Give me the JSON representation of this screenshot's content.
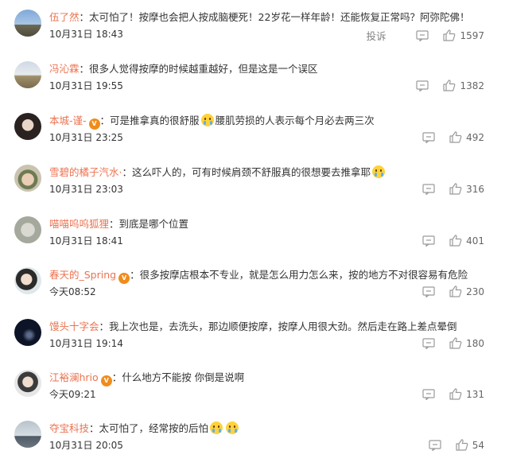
{
  "labels": {
    "report": "投诉"
  },
  "colors": {
    "username": "#eb7350",
    "text": "#333333",
    "icon": "#9a9a9a"
  },
  "comments": [
    {
      "user": "伍了然",
      "vip": false,
      "sep": "：",
      "text": "太可怕了！按摩也会把人按成脑梗死！22岁花一样年龄！还能恢复正常吗？阿弥陀佛！",
      "emojis": [],
      "time": "10月31日 18:43",
      "likes": "1597",
      "report": true
    },
    {
      "user": "冯沁霖",
      "vip": false,
      "sep": "：",
      "text": "很多人觉得按摩的时候越重越好，但是这是一个误区",
      "emojis": [],
      "time": "10月31日 19:55",
      "likes": "1382",
      "report": false
    },
    {
      "user": "本城-谨-",
      "vip": true,
      "sep": "：",
      "text": "可是推拿真的很舒服",
      "text2": "腰肌劳损的人表示每个月必去两三次",
      "emojis": [
        "crying-face"
      ],
      "time": "10月31日 23:25",
      "likes": "492",
      "report": false
    },
    {
      "user": "雪碧的橘子汽水·",
      "vip": false,
      "sep": "：",
      "text": "这么吓人的，可有时候肩颈不舒服真的很想要去推拿耶",
      "emojis": [
        "crying-face"
      ],
      "time": "10月31日 23:03",
      "likes": "316",
      "report": false
    },
    {
      "user": "喵喵呜呜狐狸",
      "vip": false,
      "sep": "：",
      "text": "到底是哪个位置",
      "emojis": [],
      "time": "10月31日 18:41",
      "likes": "401",
      "report": false
    },
    {
      "user": "春天的_Spring",
      "vip": true,
      "sep": "：",
      "text": "很多按摩店根本不专业，就是怎么用力怎么来，按的地方不对很容易有危险",
      "emojis": [],
      "time": "今天08:52",
      "likes": "230",
      "report": false
    },
    {
      "user": "馒头十字会",
      "vip": false,
      "sep": "：",
      "text": "我上次也是，去洗头，那边顺便按摩，按摩人用很大劲。然后走在路上差点晕倒",
      "emojis": [],
      "time": "10月31日 19:14",
      "likes": "180",
      "report": false
    },
    {
      "user": "江裕澜hrio",
      "vip": true,
      "sep": "：",
      "text": "什么地方不能按 你倒是说啊",
      "emojis": [],
      "time": "今天09:21",
      "likes": "131",
      "report": false
    },
    {
      "user": "夺宝科技",
      "vip": false,
      "sep": "：",
      "text": "太可怕了，经常按的后怕",
      "emojis": [
        "crying-face",
        "crying-face"
      ],
      "time": "10月31日 20:05",
      "likes": "54",
      "report": false
    }
  ]
}
